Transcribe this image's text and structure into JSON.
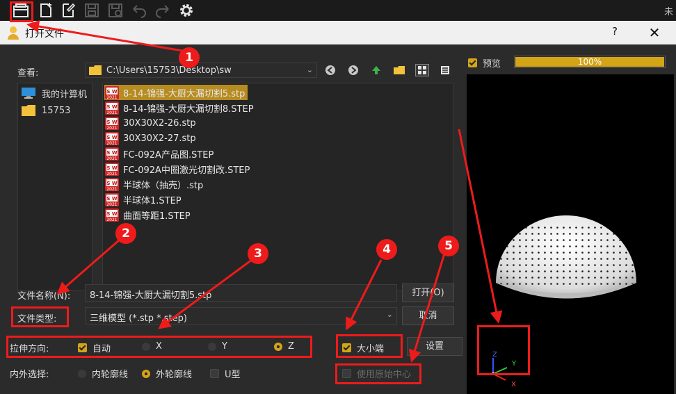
{
  "toolbar": {
    "buttons": [
      "open-file-icon",
      "new-file-icon",
      "edit-file-icon",
      "save-icon",
      "save-as-icon",
      "undo-icon",
      "redo-icon",
      "gear-icon"
    ],
    "right_text": "未"
  },
  "dialog": {
    "title": "打开文件",
    "help": "?",
    "close": "✕",
    "look_in_label": "查看:",
    "path": "C:\\Users\\15753\\Desktop\\sw",
    "sidebar": [
      {
        "label": "我的计算机",
        "icon": "computer-icon"
      },
      {
        "label": "15753",
        "icon": "folder-icon"
      }
    ],
    "files": [
      "8-14-锦强-大厨大漏切割5.stp",
      "8-14-锦强-大厨大漏切割8.STEP",
      "30X30X2-26.stp",
      "30X30X2-27.stp",
      "FC-092A产品图.STEP",
      "FC-092A中圈激光切割改.STEP",
      "半球体（抽壳）.stp",
      "半球体1.STEP",
      "曲面等距1.STEP"
    ],
    "selected_file_index": 0,
    "sw_badge": {
      "top": "S W",
      "year": "2021"
    },
    "filename_label": "文件名称(N):",
    "filename_value": "8-14-锦强-大厨大漏切割5.stp",
    "filetype_label": "文件类型:",
    "filetype_value": "三维模型 (*.stp *.step)",
    "open_button": "打开(O)",
    "cancel_button": "取消",
    "stretch_label": "拉伸方向:",
    "stretch_options": [
      {
        "label": "自动",
        "kind": "checkbox",
        "checked": true
      },
      {
        "label": "X",
        "kind": "radio",
        "checked": false
      },
      {
        "label": "Y",
        "kind": "radio",
        "checked": false
      },
      {
        "label": "Z",
        "kind": "radio",
        "checked": true
      }
    ],
    "endian_label": "大小端",
    "endian_checked": true,
    "settings_button": "设置",
    "inout_label": "内外选择:",
    "inout_options": [
      {
        "label": "内轮廓线",
        "kind": "radio",
        "checked": false
      },
      {
        "label": "外轮廓线",
        "kind": "radio",
        "checked": true
      },
      {
        "label": "U型",
        "kind": "checkbox",
        "checked": false
      }
    ],
    "origin_label": "使用原始中心",
    "origin_checked": false,
    "preview_label": "预览",
    "preview_checked": true,
    "progress_text": "100%",
    "progress_value": 1.0,
    "axes": {
      "z": "Z",
      "y": "Y",
      "x": "X"
    }
  },
  "annotations": [
    "1",
    "2",
    "3",
    "4",
    "5"
  ],
  "colors": {
    "accent": "#d4a417",
    "selection": "#b68b20",
    "annotation": "#ee1b1b"
  }
}
